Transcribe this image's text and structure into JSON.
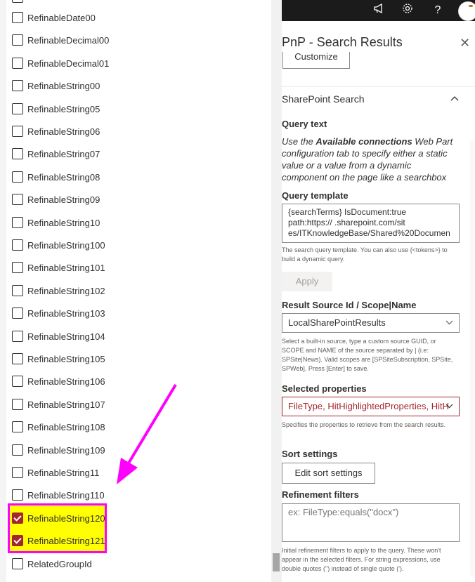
{
  "topbar": {
    "icons": [
      "megaphone-icon",
      "gear-icon",
      "help-icon"
    ],
    "help_glyph": "?"
  },
  "refiners": {
    "items": [
      {
        "label": "RefinableDate00",
        "checked": false
      },
      {
        "label": "RefinableDecimal00",
        "checked": false
      },
      {
        "label": "RefinableDecimal01",
        "checked": false
      },
      {
        "label": "RefinableString00",
        "checked": false
      },
      {
        "label": "RefinableString05",
        "checked": false
      },
      {
        "label": "RefinableString06",
        "checked": false
      },
      {
        "label": "RefinableString07",
        "checked": false
      },
      {
        "label": "RefinableString08",
        "checked": false
      },
      {
        "label": "RefinableString09",
        "checked": false
      },
      {
        "label": "RefinableString10",
        "checked": false
      },
      {
        "label": "RefinableString100",
        "checked": false
      },
      {
        "label": "RefinableString101",
        "checked": false
      },
      {
        "label": "RefinableString102",
        "checked": false
      },
      {
        "label": "RefinableString103",
        "checked": false
      },
      {
        "label": "RefinableString104",
        "checked": false
      },
      {
        "label": "RefinableString105",
        "checked": false
      },
      {
        "label": "RefinableString106",
        "checked": false
      },
      {
        "label": "RefinableString107",
        "checked": false
      },
      {
        "label": "RefinableString108",
        "checked": false
      },
      {
        "label": "RefinableString109",
        "checked": false
      },
      {
        "label": "RefinableString11",
        "checked": false
      },
      {
        "label": "RefinableString110",
        "checked": false
      },
      {
        "label": "RefinableString120",
        "checked": true
      },
      {
        "label": "RefinableString121",
        "checked": true
      },
      {
        "label": "RelatedGroupId",
        "checked": false
      }
    ],
    "highlight_color": "#ffff00",
    "annotation_color": "#ff00ff",
    "checked_color": "#a4262c"
  },
  "pane": {
    "title": "PnP - Search Results",
    "close_glyph": "✕",
    "customize_label": "Customize",
    "section_title": "SharePoint Search",
    "query_text_label": "Query text",
    "query_text_desc_pre": "Use the ",
    "query_text_desc_bold": "Available connections",
    "query_text_desc_post": " Web Part configuration tab to specify either a static value or a value from a dynamic component on the page like a searchbox",
    "query_template_label": "Query template",
    "query_template_line1": "{searchTerms} IsDocument:true",
    "query_template_line2": "path:https://              .sharepoint.com/sit",
    "query_template_line3": "es/ITKnowledgeBase/Shared%20Documen",
    "query_template_help": "The search query template. You can also use {<tokens>} to build a dynamic query.",
    "apply_label": "Apply",
    "result_source_label": "Result Source Id / Scope|Name",
    "result_source_value": "LocalSharePointResults",
    "result_source_help": "Select a built-in source, type a custom source GUID, or SCOPE and NAME of the source separated by | (i.e: SPSite|News). Valid scopes are [SPSiteSubscription, SPSite, SPWeb]. Press [Enter] to save.",
    "selected_props_label": "Selected properties",
    "selected_props_value": "FileType, HitHighlightedProperties, HitH",
    "selected_props_help": "Specifies the properties to retrieve from the search results.",
    "sort_settings_label": "Sort settings",
    "sort_button_label": "Edit sort settings",
    "refinement_label": "Refinement filters",
    "refinement_placeholder": "ex: FileType:equals(\"docx\")",
    "refinement_help": "Initial refinement filters to apply to the query. These won't appear in the selected filters. For string expressions, use double quotes (\") instead of single quote (')."
  }
}
